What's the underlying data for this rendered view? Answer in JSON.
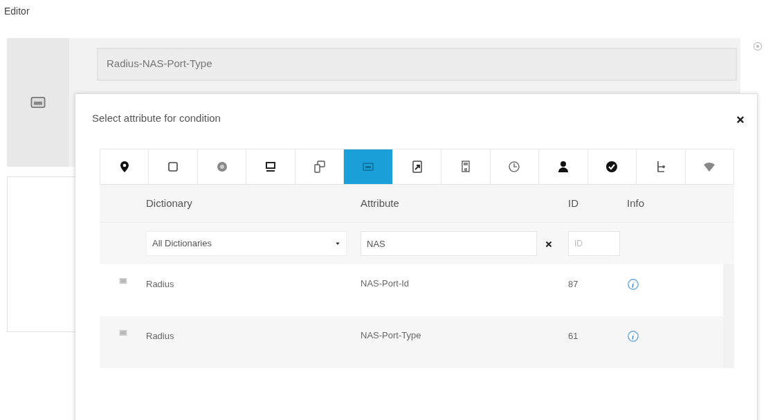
{
  "page_title": "Editor",
  "condition": {
    "value": "Radius-NAS-Port-Type"
  },
  "popover": {
    "title": "Select attribute for condition",
    "tabs": [
      {
        "selected": false
      },
      {
        "selected": false
      },
      {
        "selected": false
      },
      {
        "selected": false
      },
      {
        "selected": false
      },
      {
        "selected": true
      },
      {
        "selected": false
      },
      {
        "selected": false
      },
      {
        "selected": false
      },
      {
        "selected": false
      },
      {
        "selected": false
      },
      {
        "selected": false
      },
      {
        "selected": false
      }
    ],
    "columns": [
      "Dictionary",
      "Attribute",
      "ID",
      "Info"
    ],
    "filters": {
      "dictionary": "All Dictionaries",
      "attribute": "NAS",
      "id_placeholder": "ID"
    },
    "rows": [
      {
        "dictionary": "Radius",
        "attribute": "NAS-Port-Id",
        "id": "87"
      },
      {
        "dictionary": "Radius",
        "attribute": "NAS-Port-Type",
        "id": "61"
      }
    ]
  }
}
